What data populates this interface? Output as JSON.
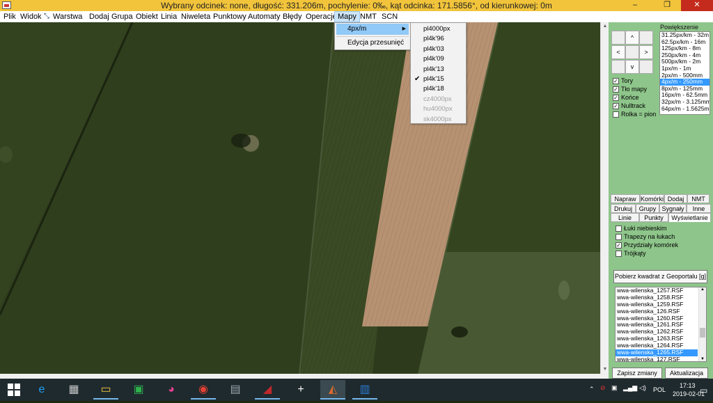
{
  "window": {
    "title": "Wybrany odcinek: none, długość: 331.206m, pochylenie: 0‰, kąt odcinka: 171.5856°, od kierunkowej: 0m",
    "minimize": "–",
    "maximize": "❐",
    "close": "✕"
  },
  "menubar": [
    {
      "label": "Plik"
    },
    {
      "label": "Widok"
    },
    {
      "label": "Warstwa"
    },
    {
      "label": "Dodaj"
    },
    {
      "label": "Grupa"
    },
    {
      "label": "Obiekt"
    },
    {
      "label": "Linia"
    },
    {
      "label": "Niweleta"
    },
    {
      "label": "Punktowy"
    },
    {
      "label": "Automaty"
    },
    {
      "label": "Błędy"
    },
    {
      "label": "Operacje"
    },
    {
      "label": "Mapy"
    },
    {
      "label": "NMT"
    },
    {
      "label": "SCN"
    }
  ],
  "maps_menu": {
    "items": [
      {
        "label": "4px/m",
        "arrow": "▶"
      },
      {
        "label": "Edycja przesunięć"
      }
    ]
  },
  "submenu": {
    "items": [
      {
        "label": "pl4000px",
        "enabled": true,
        "checked": false
      },
      {
        "label": "pl4k'96",
        "enabled": true,
        "checked": false
      },
      {
        "label": "pl4k'03",
        "enabled": true,
        "checked": false
      },
      {
        "label": "pl4k'09",
        "enabled": true,
        "checked": false
      },
      {
        "label": "pl4k'13",
        "enabled": true,
        "checked": false
      },
      {
        "label": "pl4k'15",
        "enabled": true,
        "checked": true
      },
      {
        "label": "pl4k'18",
        "enabled": true,
        "checked": false
      },
      {
        "label": "cz4000px",
        "enabled": false,
        "checked": false
      },
      {
        "label": "hu4000px",
        "enabled": false,
        "checked": false
      },
      {
        "label": "sk4000px",
        "enabled": false,
        "checked": false
      }
    ],
    "check_glyph": "✔"
  },
  "panel": {
    "nav": {
      "up": "^",
      "left": "<",
      "right": ">",
      "down": "v"
    },
    "zoom_label": "Powiększenie",
    "zoom_levels": [
      "31.25px/km - 32m",
      "62.5px/km - 16m",
      "125px/km - 8m",
      "250px/km - 4m",
      "500px/km - 2m",
      "1px/m - 1m",
      "2px/m - 500mm",
      "4px/m - 250mm",
      "8px/m - 125mm",
      "16px/m - 62.5mm",
      "32px/m - 3.125mm",
      "64px/m - 1.5625mm"
    ],
    "zoom_selected": "4px/m - 250mm",
    "layers": [
      {
        "label": "Tory",
        "checked": true
      },
      {
        "label": "Tło mapy",
        "checked": true
      },
      {
        "label": "Końce",
        "checked": true
      },
      {
        "label": "Nulltrack",
        "checked": true
      },
      {
        "label": "Rolka = pion",
        "checked": false
      }
    ],
    "tabs_row1": [
      "Napraw",
      "Komórki",
      "Dodaj",
      "NMT"
    ],
    "tabs_row2": [
      "Drukuj",
      "Grupy",
      "Sygnały",
      "Inne"
    ],
    "tabs_row3": [
      "Linie",
      "Punkty",
      "Wyświetlanie"
    ],
    "active_tab": "Wyświetlanie",
    "options": [
      {
        "label": "Łuki niebieskim",
        "checked": false
      },
      {
        "label": "Trapezy na łukach",
        "checked": false
      },
      {
        "label": "Przydziały komórek",
        "checked": true
      },
      {
        "label": "Trójkąty",
        "checked": false
      }
    ],
    "geoportal_button": "Pobierz kwadrat z Geoportalu [g]",
    "files": [
      "wwa-wilenska_1257.RSF",
      "wwa-wilenska_1258.RSF",
      "wwa-wilenska_1259.RSF",
      "wwa-wilenska_126.RSF",
      "wwa-wilenska_1260.RSF",
      "wwa-wilenska_1261.RSF",
      "wwa-wilenska_1262.RSF",
      "wwa-wilenska_1263.RSF",
      "wwa-wilenska_1264.RSF",
      "wwa-wilenska_1265.RSF",
      "wwa-wilenska_127.RSF"
    ],
    "file_selected": "wwa-wilenska_1265.RSF",
    "save_button": "Zapisz zmiany",
    "update_button": "Aktualizacja"
  },
  "taskbar": {
    "start_icon": "windows-logo",
    "apps": [
      {
        "name": "internet-explorer-icon",
        "glyph": "e",
        "color": "#1ea1f2"
      },
      {
        "name": "app-icon-generic",
        "glyph": "▦",
        "color": "#c8c8c8"
      },
      {
        "name": "file-explorer-icon",
        "glyph": "▭",
        "color": "#f2c43b"
      },
      {
        "name": "store-icon",
        "glyph": "▣",
        "color": "#2eb04c"
      },
      {
        "name": "paint-icon",
        "glyph": "◕",
        "color": "#e04090"
      },
      {
        "name": "chrome-icon",
        "glyph": "◉",
        "color": "#e34133"
      },
      {
        "name": "calculator-icon",
        "glyph": "▤",
        "color": "#9aa5ad"
      },
      {
        "name": "rail-app-icon",
        "glyph": "◢",
        "color": "#c0282b"
      },
      {
        "name": "plus-app-icon",
        "glyph": "+",
        "color": "#ffffff"
      },
      {
        "name": "rail-editor-icon",
        "glyph": "◭",
        "color": "#d86a30"
      },
      {
        "name": "notepad-icon",
        "glyph": "▥",
        "color": "#2b7cd3"
      }
    ],
    "lang": "POL",
    "time": "17:13",
    "date": "2019-02-01"
  },
  "colors": {
    "titlebar": "#f2c43b",
    "panel": "#8ec58a",
    "selection": "#3399ff",
    "field_light": "#b79272"
  }
}
